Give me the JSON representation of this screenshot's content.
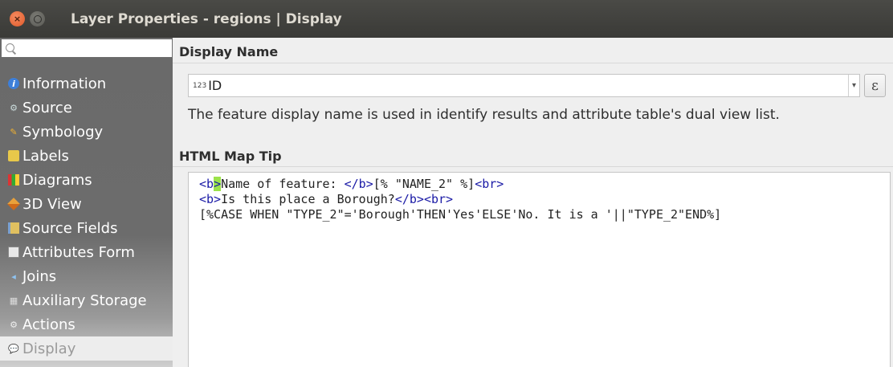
{
  "window": {
    "title": "Layer Properties - regions | Display",
    "close_glyph": "×"
  },
  "sidebar": {
    "search_placeholder": "",
    "items": [
      {
        "label": "Information",
        "icon": "info-icon"
      },
      {
        "label": "Source",
        "icon": "source-icon"
      },
      {
        "label": "Symbology",
        "icon": "symbology-icon"
      },
      {
        "label": "Labels",
        "icon": "labels-icon"
      },
      {
        "label": "Diagrams",
        "icon": "diagrams-icon"
      },
      {
        "label": "3D View",
        "icon": "3d-view-icon"
      },
      {
        "label": "Source Fields",
        "icon": "source-fields-icon"
      },
      {
        "label": "Attributes Form",
        "icon": "attributes-form-icon"
      },
      {
        "label": "Joins",
        "icon": "joins-icon"
      },
      {
        "label": "Auxiliary Storage",
        "icon": "auxiliary-storage-icon"
      },
      {
        "label": "Actions",
        "icon": "actions-icon"
      },
      {
        "label": "Display",
        "icon": "display-icon",
        "selected": true
      }
    ]
  },
  "display_name": {
    "section_title": "Display Name",
    "field_type_badge": "123",
    "field_value": "ID",
    "expression_button": "ε",
    "description": "The feature display name is used in identify results and attribute table's dual view list."
  },
  "map_tip": {
    "section_title": "HTML Map Tip",
    "lines": [
      {
        "open_tag_start": "<b",
        "open_tag_end": ">",
        "text": "Name of feature: ",
        "close_tag": "</b>",
        "expr": "[% \"NAME_2\" %]",
        "br": "<br>"
      },
      {
        "open_tag": "<b>",
        "text": "Is this place a Borough?",
        "close_tag": "</b>",
        "br": "<br>"
      },
      {
        "text": "[%CASE WHEN \"TYPE_2\"='Borough'THEN'Yes'ELSE'No. It is a '||\"TYPE_2\"END%]"
      }
    ]
  },
  "colors": {
    "titlebar": "#3f3f3c",
    "sidebar": "#6c6c6c",
    "tag": "#1a1aa6",
    "bracket_highlight": "#9be34a"
  }
}
